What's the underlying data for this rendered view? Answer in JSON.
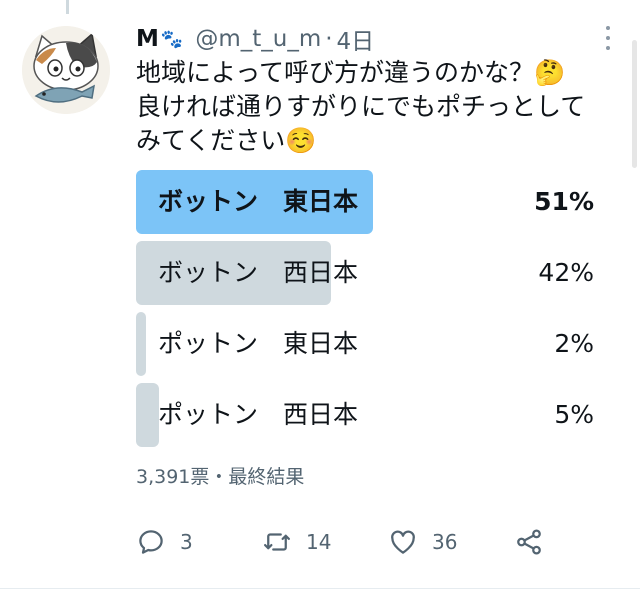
{
  "tweet": {
    "display_name": "M",
    "name_emoji": "🐾",
    "handle": "@m_t_u_m",
    "separator": "·",
    "time": "4日",
    "text": "地域によって呼び方が違うのかな？🤔\n良ければ通りすがりにでもポチっとして\nみてください☺️"
  },
  "poll": {
    "options": [
      {
        "label": "ボットン　東日本",
        "percent_label": "51%",
        "percent": 51,
        "winner": true
      },
      {
        "label": "ボットン　西日本",
        "percent_label": "42%",
        "percent": 42,
        "winner": false
      },
      {
        "label": "ポットン　東日本",
        "percent_label": "2%",
        "percent": 2,
        "winner": false
      },
      {
        "label": "ポットン　西日本",
        "percent_label": "5%",
        "percent": 5,
        "winner": false
      }
    ],
    "votes_text": "3,391票・最終結果"
  },
  "actions": {
    "reply_count": "3",
    "retweet_count": "14",
    "like_count": "36"
  },
  "colors": {
    "winner_bar": "#7cc4f7",
    "other_bar": "#cfd9de",
    "secondary_text": "#536471"
  },
  "icons": [
    "paw-icon",
    "more-icon",
    "reply-icon",
    "retweet-icon",
    "like-icon",
    "share-icon"
  ]
}
